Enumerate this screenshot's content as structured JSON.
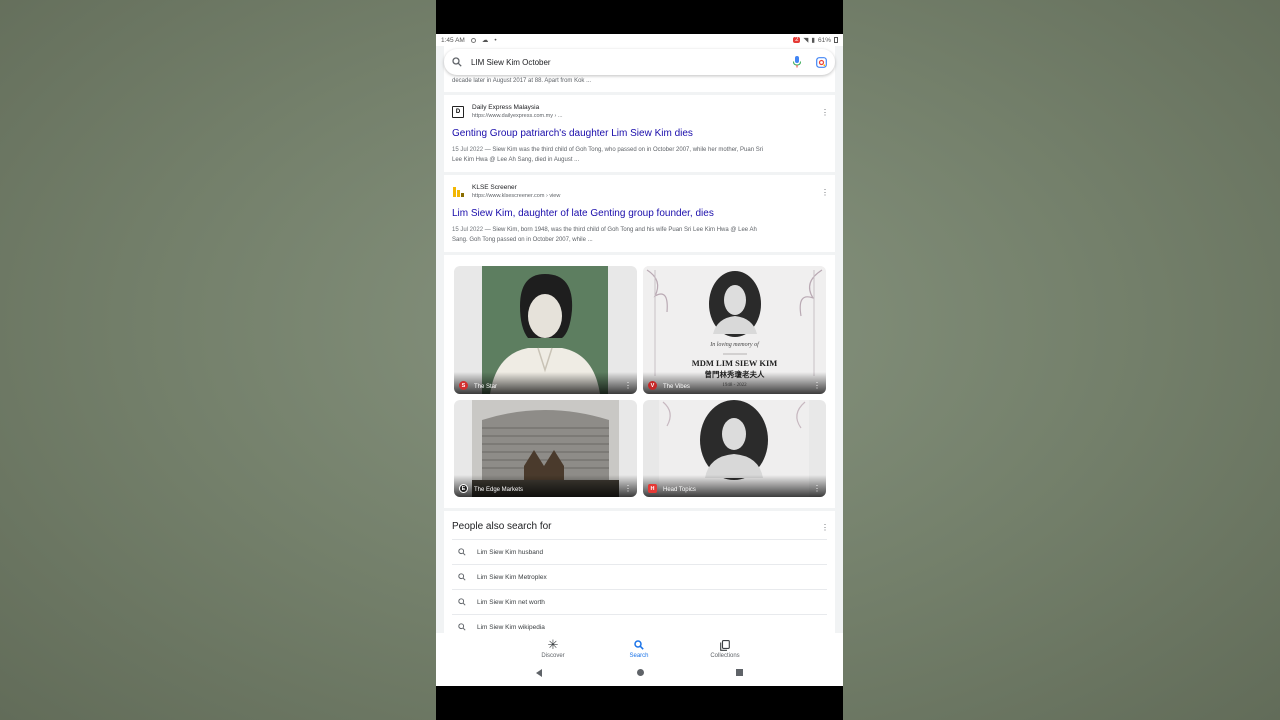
{
  "status_bar": {
    "time": "1:45 AM",
    "notification_count": "2",
    "battery": "61%"
  },
  "search": {
    "query": "LIM Siew Kim October"
  },
  "prev_snippet_tail": "decade later in August 2017 at 88. Apart from Kok ...",
  "results": [
    {
      "source": "Daily Express Malaysia",
      "favicon_text": "D",
      "url": "https://www.dailyexpress.com.my › ...",
      "title": "Genting Group patriarch's daughter Lim Siew Kim dies",
      "date": "15 Jul 2022",
      "snippet_line1": " — Siew Kim was the third child of Goh Tong, who passed on in October 2007, while her mother, Puan Sri",
      "snippet_line2": "Lee Kim Hwa @ Lee Ah Sang, died in August ..."
    },
    {
      "source": "KLSE Screener",
      "favicon_text": "",
      "url": "https://www.klsescreener.com › view",
      "title": "Lim Siew Kim, daughter of late Genting group founder, dies",
      "date": "15 Jul 2022",
      "snippet_line1": " — Siew Kim, born 1948, was the third child of Goh Tong and his wife Puan Sri Lee Kim Hwa @ Lee Ah",
      "snippet_line2": "Sang. Goh Tong passed on in October 2007, while ..."
    }
  ],
  "images": [
    {
      "source": "The Star",
      "badge": "S",
      "badge_color": "#d32f2f"
    },
    {
      "source": "The Vibes",
      "badge": "V",
      "badge_color": "#c62828",
      "memorial_caption": "In loving memory of",
      "memorial_name": "MDM LIM SIEW KIM",
      "memorial_chinese": "曾門林秀瓊老夫人",
      "memorial_years": "1948 - 2022"
    },
    {
      "source": "The Edge Markets",
      "badge": "E",
      "badge_color": "#212121"
    },
    {
      "source": "Head Topics",
      "badge": "H",
      "badge_color": "#e53935"
    }
  ],
  "people_also_search": {
    "title": "People also search for",
    "items": [
      "Lim Siew Kim husband",
      "Lim Siew Kim Metroplex",
      "Lim Siew Kim net worth",
      "Lim Siew Kim wikipedia"
    ]
  },
  "bottom_nav": {
    "discover": "Discover",
    "search": "Search",
    "collections": "Collections"
  },
  "colors": {
    "link": "#1a0dab",
    "accent": "#1a73e8"
  }
}
